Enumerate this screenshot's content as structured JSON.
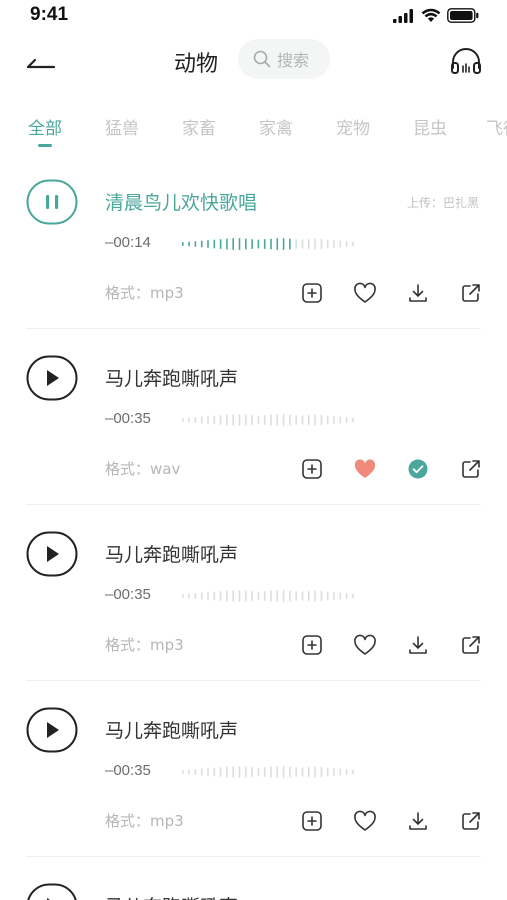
{
  "status_bar": {
    "time": "9:41"
  },
  "header": {
    "title": "动物",
    "search_placeholder": "搜索"
  },
  "tabs": [
    {
      "label": "全部",
      "active": true
    },
    {
      "label": "猛兽",
      "active": false
    },
    {
      "label": "家畜",
      "active": false
    },
    {
      "label": "家禽",
      "active": false
    },
    {
      "label": "宠物",
      "active": false
    },
    {
      "label": "昆虫",
      "active": false
    },
    {
      "label": "飞行",
      "active": false
    }
  ],
  "colors": {
    "accent": "#4aa79b",
    "liked": "#f08a7a",
    "text": "#333333",
    "muted": "#b5b7b7"
  },
  "items": [
    {
      "title": "清晨鸟儿欢快歌唱",
      "uploader": "上传：巴扎黑",
      "duration": "–00:14",
      "format": "格式：mp3",
      "playing": true,
      "progress": 0.62,
      "liked": false,
      "downloaded": false
    },
    {
      "title": "马儿奔跑嘶吼声",
      "uploader": "",
      "duration": "–00:35",
      "format": "格式：wav",
      "playing": false,
      "progress": 0,
      "liked": true,
      "downloaded": true
    },
    {
      "title": "马儿奔跑嘶吼声",
      "uploader": "",
      "duration": "–00:35",
      "format": "格式：mp3",
      "playing": false,
      "progress": 0,
      "liked": false,
      "downloaded": false
    },
    {
      "title": "马儿奔跑嘶吼声",
      "uploader": "",
      "duration": "–00:35",
      "format": "格式：mp3",
      "playing": false,
      "progress": 0,
      "liked": false,
      "downloaded": false
    },
    {
      "title": "马儿奔跑嘶吼声",
      "uploader": "",
      "duration": "",
      "format": "",
      "playing": false,
      "progress": 0,
      "liked": false,
      "downloaded": false
    }
  ]
}
